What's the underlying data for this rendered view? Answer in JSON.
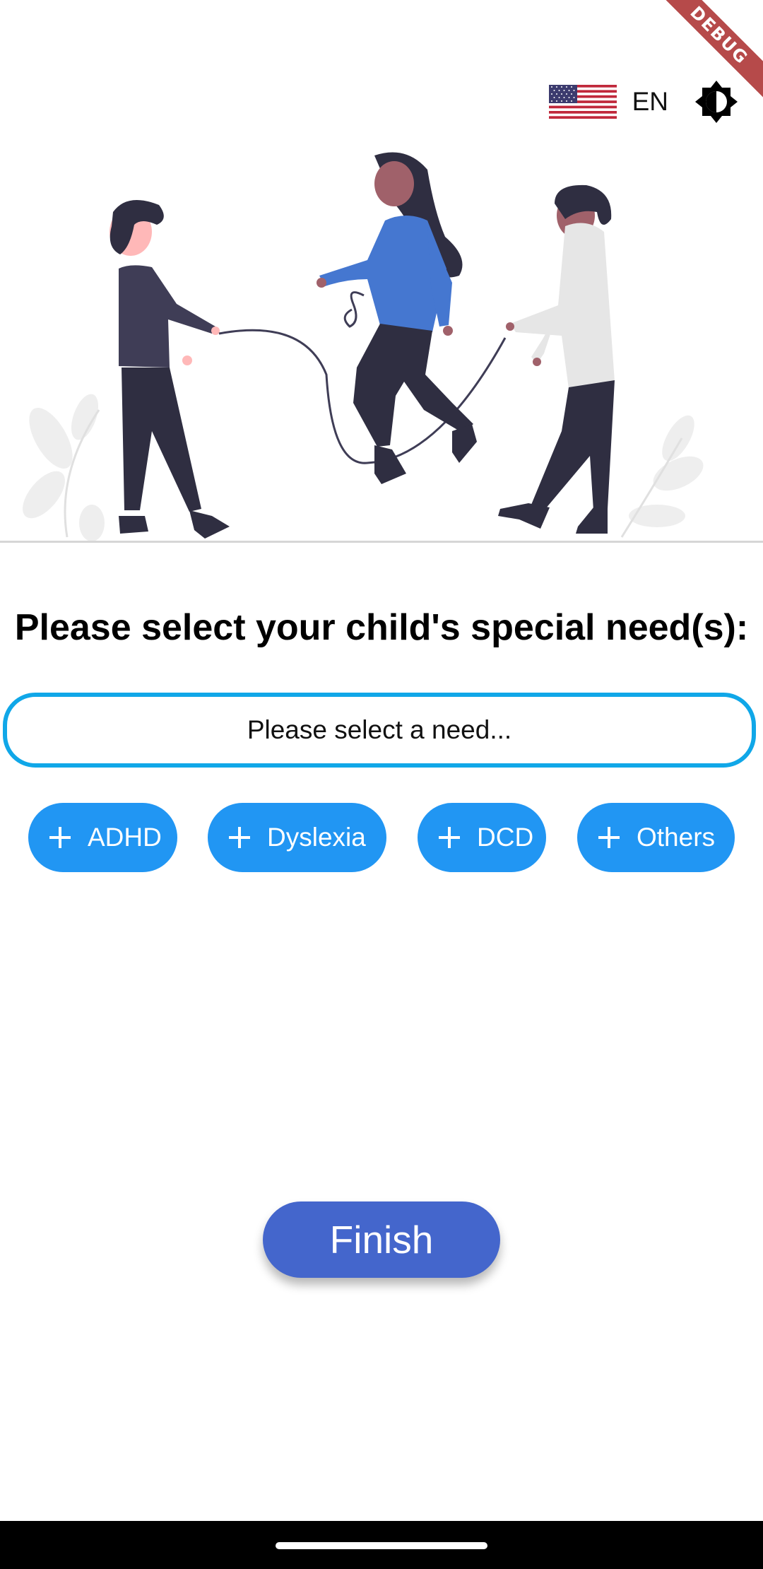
{
  "app": {
    "debug_banner": "DEBUG"
  },
  "header": {
    "language_code": "EN",
    "flag_icon": "us-flag-icon",
    "theme_toggle_icon": "brightness-icon"
  },
  "hero": {
    "illustration": "children-jumping-rope-illustration"
  },
  "form": {
    "question": "Please select your child's special need(s):",
    "select_placeholder": "Please select a need...",
    "accent_color": "#10a7e8"
  },
  "chips": [
    {
      "label": "ADHD",
      "icon": "plus-icon"
    },
    {
      "label": "Dyslexia",
      "icon": "plus-icon"
    },
    {
      "label": "DCD",
      "icon": "plus-icon"
    },
    {
      "label": "Others",
      "icon": "plus-icon"
    }
  ],
  "chip_color": "#2196f3",
  "actions": {
    "finish_label": "Finish",
    "finish_color": "#4466cc"
  }
}
